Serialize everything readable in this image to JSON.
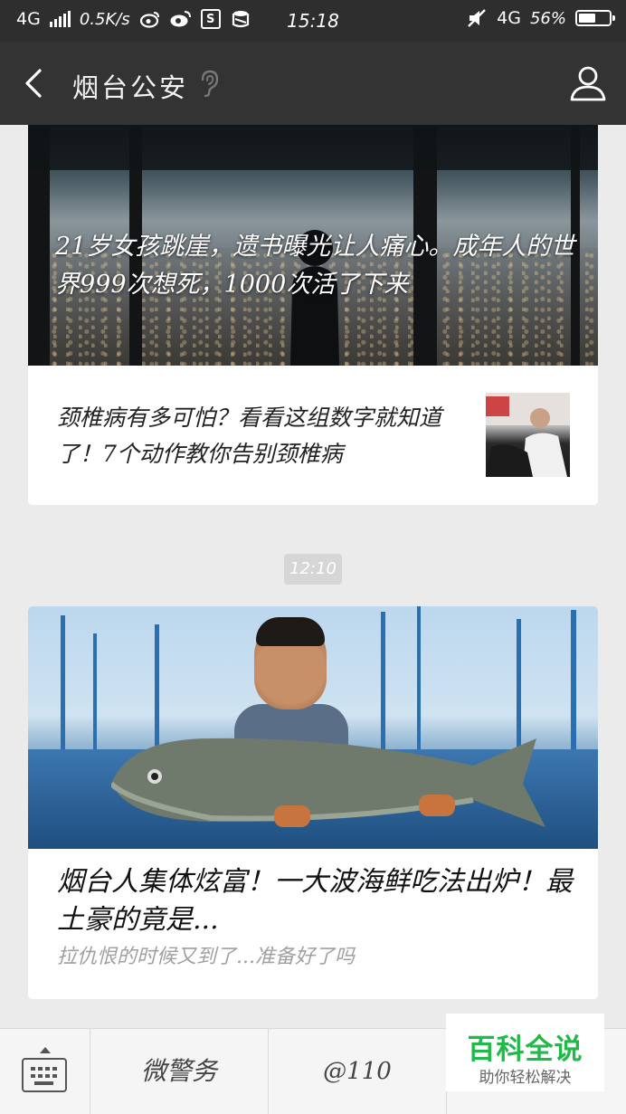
{
  "status_bar": {
    "network": "4G",
    "speed": "0.5K/s",
    "time": "15:18",
    "network_right": "4G",
    "battery": "56%",
    "battery_level": 0.56
  },
  "nav": {
    "title": "烟台公安"
  },
  "articles": [
    {
      "caption": "21岁女孩跳崖，遗书曝光让人痛心。成年人的世界999次想死，1000次活了下来"
    },
    {
      "title": "颈椎病有多可怕？看看这组数字就知道了！7个动作教你告别颈椎病"
    }
  ],
  "timestamp": "12:10",
  "article2": {
    "title": "烟台人集体炫富！一大波海鲜吃法出炉！最土豪的竟是...",
    "description": "拉仇恨的时候又到了...准备好了吗"
  },
  "bottom_menu": {
    "item1": "微警务",
    "item2": "@110"
  },
  "watermark": {
    "title": "百科全说",
    "subtitle": "助你轻松解决"
  },
  "colors": {
    "nav_bg": "#333333",
    "page_bg": "#ebebeb",
    "watermark_green": "#21b94a"
  }
}
